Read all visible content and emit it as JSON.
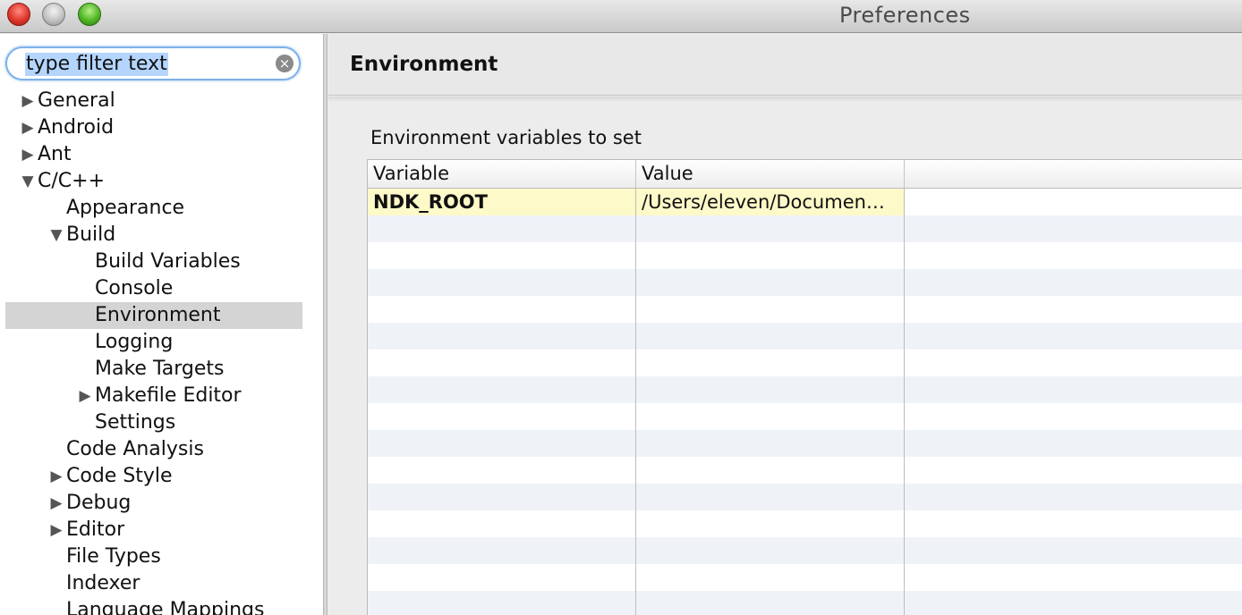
{
  "window": {
    "title": "Preferences"
  },
  "search": {
    "value": "type filter text"
  },
  "tree": [
    {
      "label": "General",
      "arrow": "right"
    },
    {
      "label": "Android",
      "arrow": "right"
    },
    {
      "label": "Ant",
      "arrow": "right"
    },
    {
      "label": "C/C++",
      "arrow": "down"
    },
    {
      "label": "Appearance",
      "arrow": ""
    },
    {
      "label": "Build",
      "arrow": "down"
    },
    {
      "label": "Build Variables",
      "arrow": ""
    },
    {
      "label": "Console",
      "arrow": ""
    },
    {
      "label": "Environment",
      "arrow": "",
      "selected": true
    },
    {
      "label": "Logging",
      "arrow": ""
    },
    {
      "label": "Make Targets",
      "arrow": ""
    },
    {
      "label": "Makefile Editor",
      "arrow": "right"
    },
    {
      "label": "Settings",
      "arrow": ""
    },
    {
      "label": "Code Analysis",
      "arrow": ""
    },
    {
      "label": "Code Style",
      "arrow": "right"
    },
    {
      "label": "Debug",
      "arrow": "right"
    },
    {
      "label": "Editor",
      "arrow": "right"
    },
    {
      "label": "File Types",
      "arrow": ""
    },
    {
      "label": "Indexer",
      "arrow": ""
    },
    {
      "label": "Language Mappings",
      "arrow": ""
    }
  ],
  "page": {
    "title": "Environment",
    "section_label": "Environment variables to set"
  },
  "table": {
    "columns": [
      "Variable",
      "Value"
    ],
    "rows": [
      {
        "variable": "NDK_ROOT",
        "value": "/Users/eleven/Documen…"
      }
    ]
  },
  "colors": {
    "selection": "#d4d4d4",
    "highlight_row": "#fdf9c8",
    "search_focus": "#7fb1e8",
    "alt_row": "#eff3f8"
  }
}
